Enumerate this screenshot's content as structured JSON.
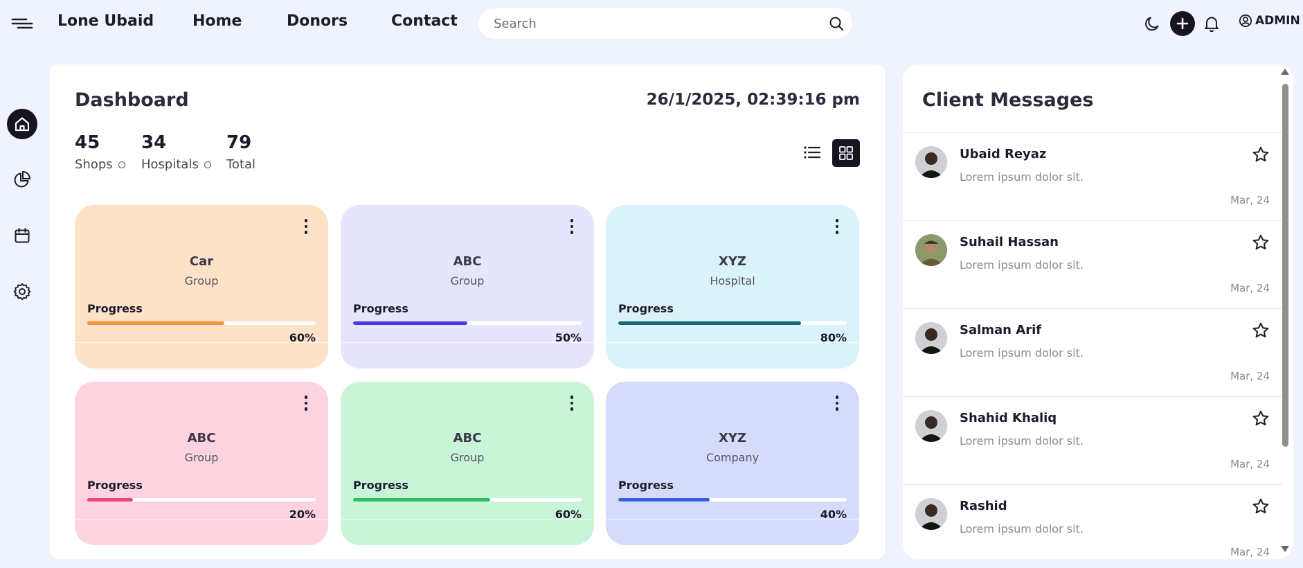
{
  "header": {
    "brand": "Lone Ubaid",
    "nav": [
      {
        "label": "Home"
      },
      {
        "label": "Donors"
      },
      {
        "label": "Contact"
      }
    ],
    "search_placeholder": "Search",
    "admin_label": "ADMIN",
    "icons": [
      "menu-icon",
      "search-icon",
      "moon-icon",
      "plus-icon",
      "bell-icon",
      "user-circle-icon"
    ]
  },
  "sidebar": {
    "items": [
      {
        "icon": "home-icon",
        "active": true
      },
      {
        "icon": "pie-chart-icon",
        "active": false
      },
      {
        "icon": "calendar-icon",
        "active": false
      },
      {
        "icon": "gear-icon",
        "active": false
      }
    ]
  },
  "dashboard": {
    "title": "Dashboard",
    "datetime": "26/1/2025, 02:39:16 pm",
    "stats": [
      {
        "value": "45",
        "label": "Shops"
      },
      {
        "value": "34",
        "label": "Hospitals"
      },
      {
        "value": "79",
        "label": "Total"
      }
    ],
    "progress_label": "Progress",
    "cards": [
      {
        "name": "Car",
        "type": "Group",
        "progress": 60,
        "progress_text": "60%",
        "bg": "#fde2c8",
        "bar": "#f5923a"
      },
      {
        "name": "ABC",
        "type": "Group",
        "progress": 50,
        "progress_text": "50%",
        "bg": "#e6e5fb",
        "bar": "#4b38e0"
      },
      {
        "name": "XYZ",
        "type": "Hospital",
        "progress": 80,
        "progress_text": "80%",
        "bg": "#daf3fb",
        "bar": "#0f6b77"
      },
      {
        "name": "ABC",
        "type": "Group",
        "progress": 20,
        "progress_text": "20%",
        "bg": "#fdd3e0",
        "bar": "#e9457d"
      },
      {
        "name": "ABC",
        "type": "Group",
        "progress": 60,
        "progress_text": "60%",
        "bg": "#c8f4d8",
        "bar": "#2cc061"
      },
      {
        "name": "XYZ",
        "type": "Company",
        "progress": 40,
        "progress_text": "40%",
        "bg": "#d5dcfb",
        "bar": "#3b5fe0"
      }
    ]
  },
  "messages": {
    "title": "Client Messages",
    "items": [
      {
        "name": "Ubaid Reyaz",
        "text": "Lorem ipsum dolor sit.",
        "date": "Mar, 24"
      },
      {
        "name": "Suhail Hassan",
        "text": "Lorem ipsum dolor sit.",
        "date": "Mar, 24"
      },
      {
        "name": "Salman Arif",
        "text": "Lorem ipsum dolor sit.",
        "date": "Mar, 24"
      },
      {
        "name": "Shahid Khaliq",
        "text": "Lorem ipsum dolor sit.",
        "date": "Mar, 24"
      },
      {
        "name": "Rashid",
        "text": "Lorem ipsum dolor sit.",
        "date": "Mar, 24"
      }
    ]
  }
}
